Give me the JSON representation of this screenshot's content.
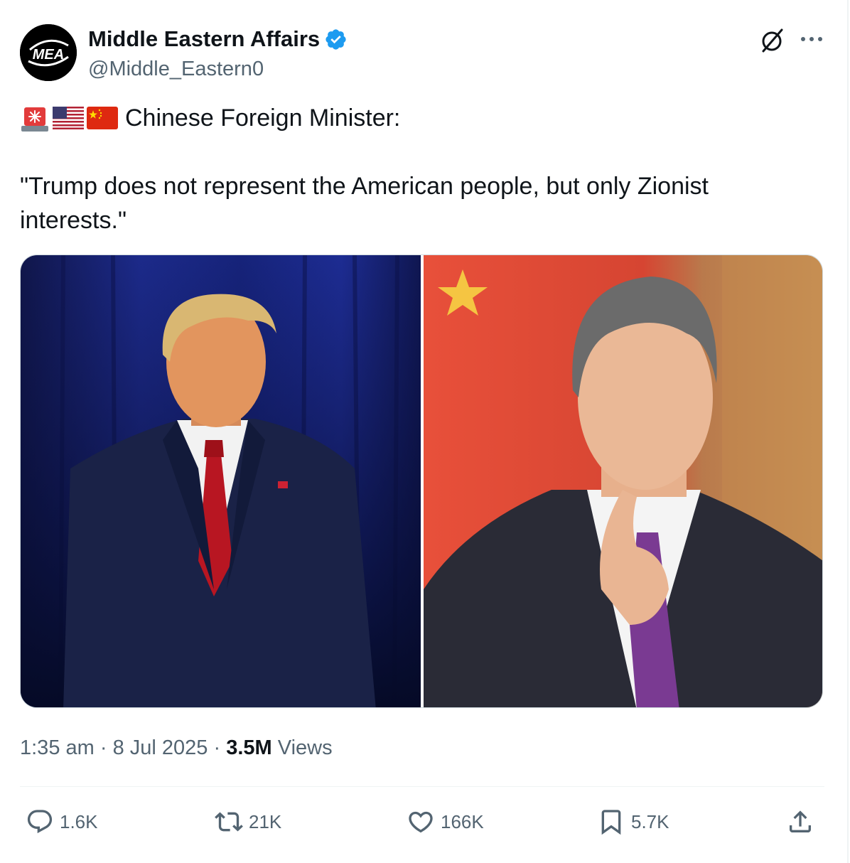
{
  "author": {
    "name": "Middle Eastern Affairs",
    "handle": "@Middle_Eastern0",
    "avatar_text": "MEA",
    "verified": true,
    "verified_color": "#1d9bf0"
  },
  "header_icons": [
    "grok-icon",
    "more-icon"
  ],
  "tweet": {
    "emojis": [
      "police-light-emoji",
      "us-flag-emoji",
      "china-flag-emoji"
    ],
    "line1": "Chinese Foreign Minister:",
    "quote": "\"Trump does not represent the American people, but only Zionist interests.\""
  },
  "media": {
    "images": [
      "photo-left",
      "photo-right"
    ]
  },
  "meta": {
    "time": "1:35 am",
    "sep1": "·",
    "date": "8 Jul 2025",
    "sep2": "·",
    "views_count": "3.5M",
    "views_label": "Views"
  },
  "actions": {
    "replies": "1.6K",
    "reposts": "21K",
    "likes": "166K",
    "bookmarks": "5.7K"
  },
  "colors": {
    "text_primary": "#0f1419",
    "text_secondary": "#536471",
    "accent": "#1d9bf0",
    "border": "#cfd9de"
  }
}
